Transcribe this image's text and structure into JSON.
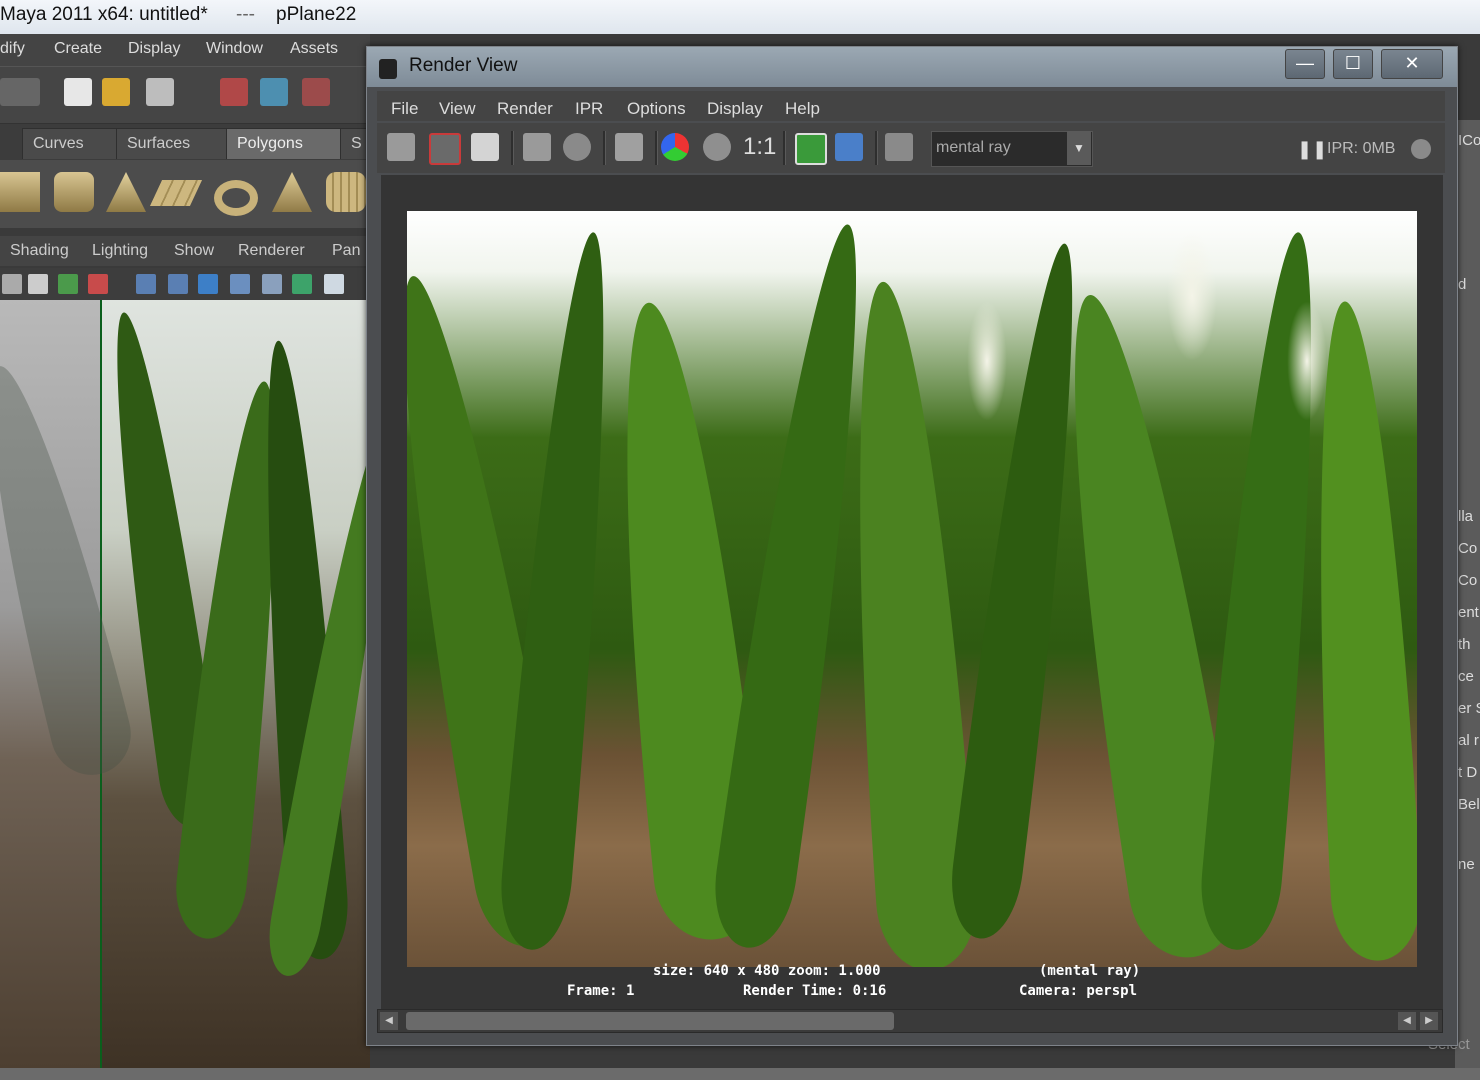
{
  "maya": {
    "title": "Maya 2011 x64: untitled*",
    "title_sep": "---",
    "title_object": "pPlane22",
    "menu": [
      "dify",
      "Create",
      "Display",
      "Window",
      "Assets"
    ],
    "shelf_tabs": [
      "Curves",
      "Surfaces",
      "Polygons",
      "S"
    ],
    "active_shelf": "Polygons",
    "panel_menu": [
      "Shading",
      "Lighting",
      "Show",
      "Renderer",
      "Pan"
    ],
    "right_panel_fragments": [
      "ICo",
      "d",
      "lla",
      "Co",
      "Co",
      "ent",
      "th",
      "ce",
      "er S",
      "al r",
      "t D",
      "Bel",
      "ne"
    ],
    "bottom_label": "Select"
  },
  "render_view": {
    "title": "Render View",
    "window_buttons": {
      "minimize": "—",
      "maximize": "☐",
      "close": "✕"
    },
    "menu": [
      "File",
      "View",
      "Render",
      "IPR",
      "Options",
      "Display",
      "Help"
    ],
    "ratio_label": "1:1",
    "renderer": "mental ray",
    "ipr_status": "IPR: 0MB",
    "info": {
      "size": "size:  640 x 480 zoom: 1.000",
      "renderer": "(mental ray)",
      "frame": "Frame:  1",
      "render_time": "Render Time: 0:16",
      "camera": "Camera: perspl"
    }
  },
  "colors": {
    "maya_bg": "#444444",
    "render_view_frame": "#4b4d50",
    "title_bar": "#8a96a2",
    "foliage": "#3c6c17",
    "soil": "#8b6c4a"
  }
}
